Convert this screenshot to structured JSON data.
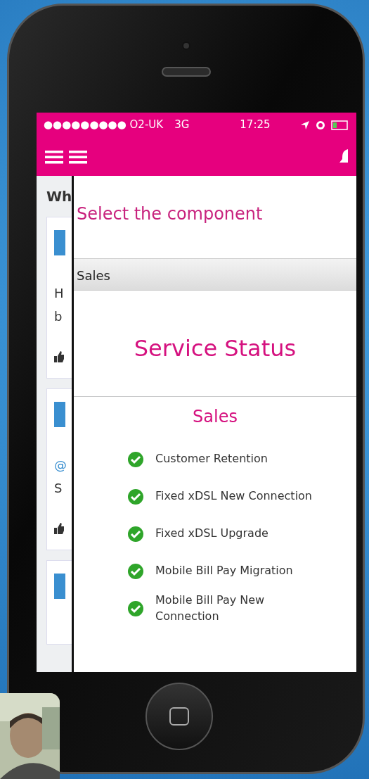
{
  "status_bar": {
    "carrier": "●●●●●●●●● O2-UK",
    "network": "3G",
    "time": "17:25"
  },
  "background_page": {
    "heading": "Wh",
    "cards": [
      {
        "avatar": true,
        "lines": [
          "H",
          "b"
        ]
      },
      {
        "avatar": true,
        "lines": [
          "@",
          "S"
        ]
      },
      {
        "avatar": true
      }
    ]
  },
  "panel": {
    "prompt": "Select the component",
    "select": {
      "value": "Sales"
    },
    "title": "Service Status",
    "section": "Sales",
    "services": [
      {
        "name": "Customer Retention",
        "ok": true
      },
      {
        "name": "Fixed xDSL New Connection",
        "ok": true
      },
      {
        "name": "Fixed xDSL Upgrade",
        "ok": true
      },
      {
        "name": "Mobile Bill Pay Migration",
        "ok": true
      },
      {
        "name": "Mobile Bill Pay New Connection",
        "ok": true
      }
    ]
  }
}
